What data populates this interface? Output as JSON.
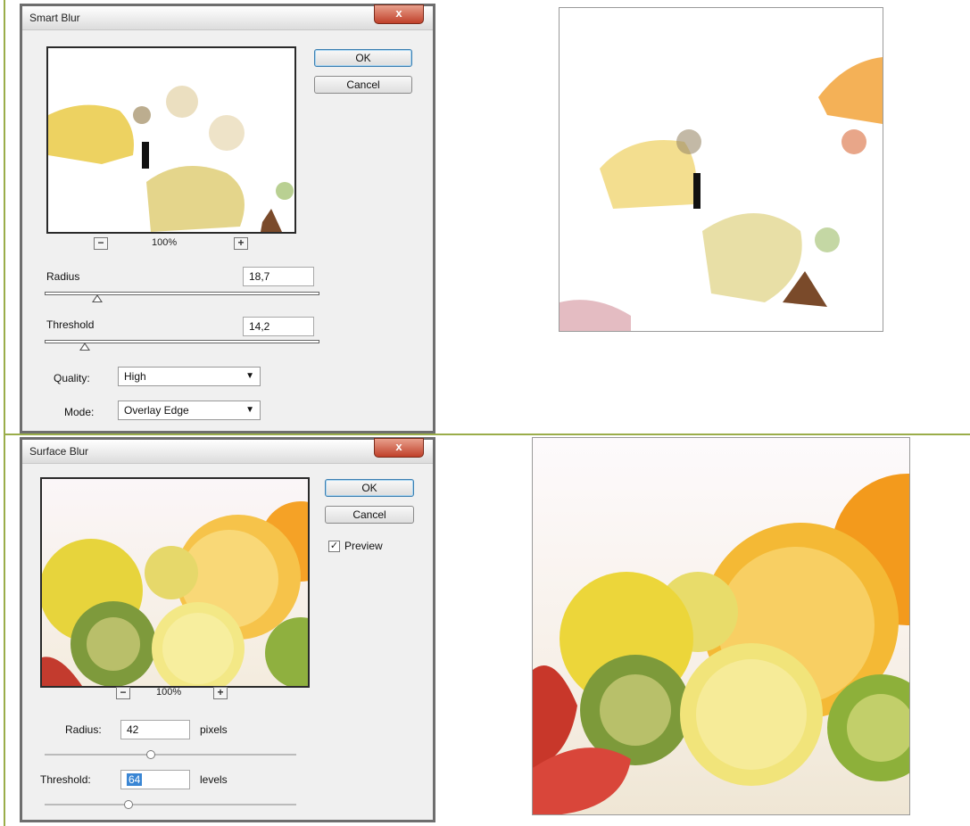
{
  "smart_blur": {
    "title": "Smart Blur",
    "close_label": "x",
    "ok_label": "OK",
    "cancel_label": "Cancel",
    "zoom_minus": "−",
    "zoom_level": "100%",
    "zoom_plus": "+",
    "radius_label": "Radius",
    "radius_value": "18,7",
    "radius_slider_fraction": 0.19,
    "threshold_label": "Threshold",
    "threshold_value": "14,2",
    "threshold_slider_fraction": 0.14,
    "quality_label": "Quality:",
    "quality_value": "High",
    "mode_label": "Mode:",
    "mode_value": "Overlay Edge"
  },
  "surface_blur": {
    "title": "Surface Blur",
    "close_label": "x",
    "ok_label": "OK",
    "cancel_label": "Cancel",
    "preview_label": "Preview",
    "preview_checked": true,
    "zoom_minus": "−",
    "zoom_level": "100%",
    "zoom_plus": "+",
    "radius_label": "Radius:",
    "radius_value": "42",
    "radius_unit": "pixels",
    "threshold_label": "Threshold:",
    "threshold_value": "64",
    "threshold_unit": "levels"
  },
  "colors": {
    "accent_line": "#9aad4a",
    "dialog_bg": "#f0f0f0",
    "close_button": "#c0402a",
    "selection": "#3a86d4"
  }
}
